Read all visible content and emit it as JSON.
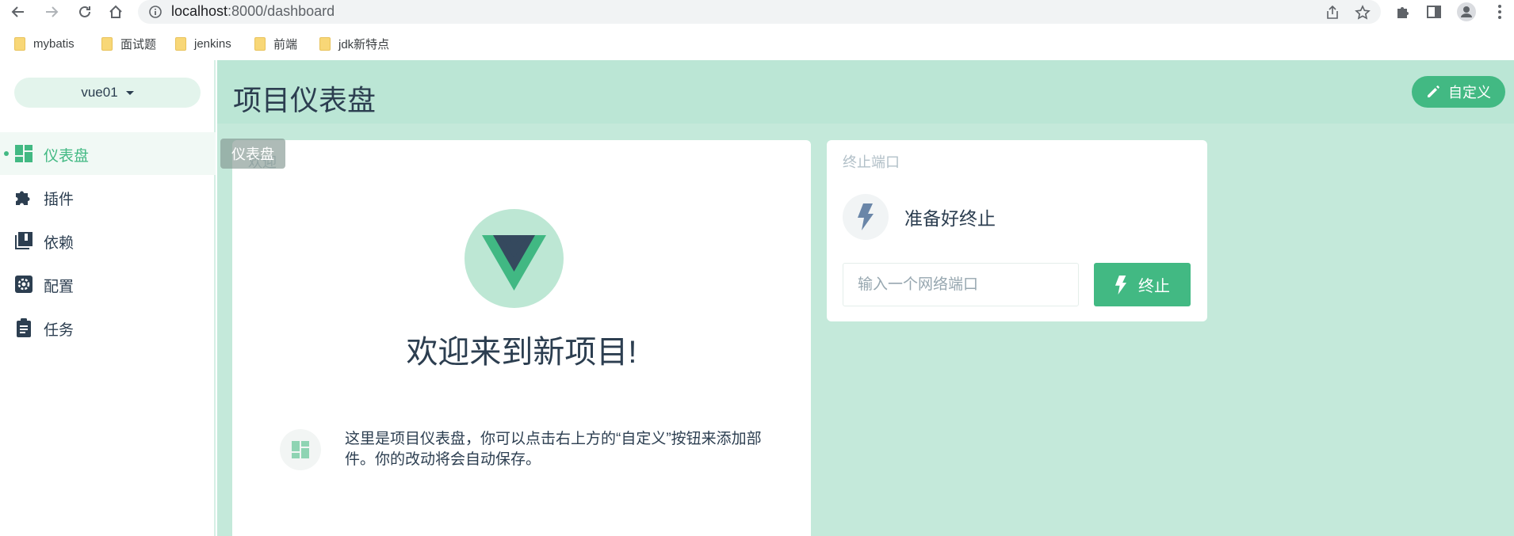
{
  "browser": {
    "url_host": "localhost",
    "url_path": ":8000/dashboard",
    "bookmarks": [
      {
        "label": "mybatis"
      },
      {
        "label": "面试题"
      },
      {
        "label": "jenkins"
      },
      {
        "label": "前端"
      },
      {
        "label": "jdk新特点"
      }
    ]
  },
  "sidebar": {
    "project": "vue01",
    "items": [
      {
        "label": "仪表盘",
        "icon": "dashboard-icon",
        "active": true
      },
      {
        "label": "插件",
        "icon": "puzzle-icon"
      },
      {
        "label": "依赖",
        "icon": "library-icon"
      },
      {
        "label": "配置",
        "icon": "settings-icon"
      },
      {
        "label": "任务",
        "icon": "clipboard-icon"
      }
    ]
  },
  "header": {
    "title": "项目仪表盘",
    "customize_label": "自定义"
  },
  "tooltip": "仪表盘",
  "welcome": {
    "card_title": "欢迎",
    "heading": "欢迎来到新项目!",
    "tip": "这里是项目仪表盘，你可以点击右上方的“自定义”按钮来添加部件。你的改动将会自动保存。"
  },
  "kill_port": {
    "card_title": "终止端口",
    "status": "准备好终止",
    "input_placeholder": "输入一个网络端口",
    "button_label": "终止"
  },
  "colors": {
    "accent": "#42b983",
    "main_bg": "#c4e9da",
    "text": "#2c3e50"
  }
}
